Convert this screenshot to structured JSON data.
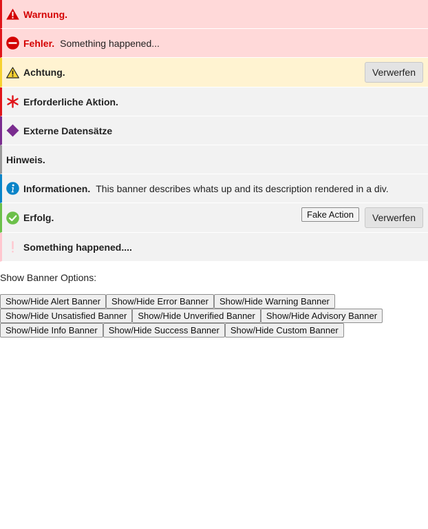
{
  "banners": {
    "alert": {
      "title": "Warnung.",
      "icon": "alert-triangle-icon",
      "color": "#e0151a"
    },
    "error": {
      "title": "Fehler.",
      "description": "Something happened...",
      "icon": "no-entry-icon",
      "color": "#e0151a"
    },
    "warning": {
      "title": "Achtung.",
      "dismiss_label": "Verwerfen",
      "icon": "warning-triangle-icon",
      "color": "#f7d22f"
    },
    "unsatisfied": {
      "title": "Erforderliche Aktion.",
      "icon": "asterisk-icon",
      "color": "#e0151a"
    },
    "unverified": {
      "title": "Externe Datensätze",
      "icon": "diamond-icon",
      "color": "#7a2c8f"
    },
    "advisory": {
      "title": "Hinweis."
    },
    "info": {
      "title": "Informationen.",
      "description": "This banner describes whats up and its description rendered in a div.",
      "icon": "info-icon",
      "color": "#0a84c8"
    },
    "success": {
      "title": "Erfolg.",
      "fake_action_label": "Fake Action",
      "dismiss_label": "Verwerfen",
      "icon": "check-circle-icon",
      "color": "#6cc04a"
    },
    "custom": {
      "title": "Something happened....",
      "icon": "exclamation-icon",
      "color": "#ffc7cf"
    }
  },
  "options": {
    "label": "Show Banner Options:",
    "rows": [
      [
        "Show/Hide Alert Banner",
        "Show/Hide Error Banner",
        "Show/Hide Warning Banner"
      ],
      [
        "Show/Hide Unsatisfied Banner",
        "Show/Hide Unverified Banner",
        "Show/Hide Advisory Banner"
      ],
      [
        "Show/Hide Info Banner",
        "Show/Hide Success Banner",
        "Show/Hide Custom Banner"
      ]
    ]
  }
}
